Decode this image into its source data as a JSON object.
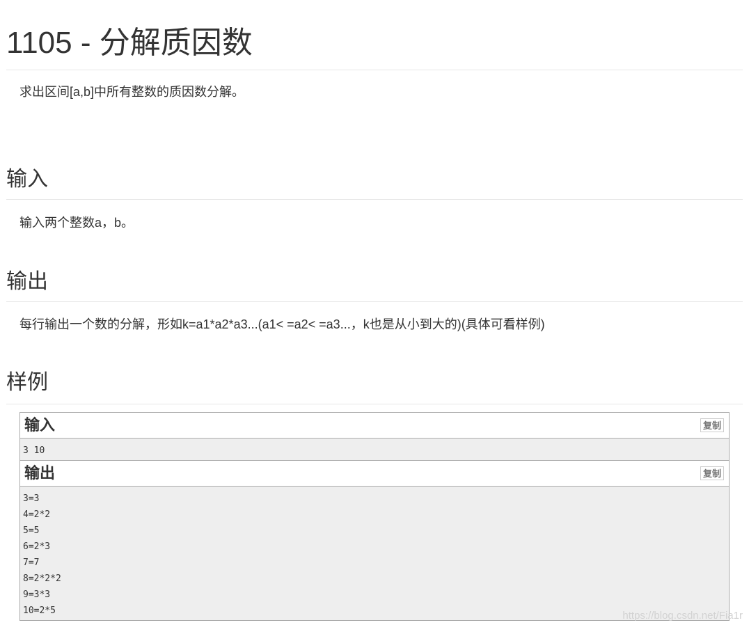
{
  "problem": {
    "title": "1105 - 分解质因数",
    "description": "求出区间[a,b]中所有整数的质因数分解。"
  },
  "input_section": {
    "heading": "输入",
    "text": "输入两个整数a，b。"
  },
  "output_section": {
    "heading": "输出",
    "text": "每行输出一个数的分解，形如k=a1*a2*a3...(a1< =a2< =a3...，k也是从小到大的)(具体可看样例)"
  },
  "sample_section": {
    "heading": "样例",
    "input_label": "输入",
    "output_label": "输出",
    "copy_label": "复制",
    "input_lines": [
      "3 10"
    ],
    "output_lines": [
      "3=3",
      "4=2*2",
      "5=5",
      "6=2*3",
      "7=7",
      "8=2*2*2",
      "9=3*3",
      "10=2*5"
    ]
  },
  "watermark": "https://blog.csdn.net/Fia1r"
}
